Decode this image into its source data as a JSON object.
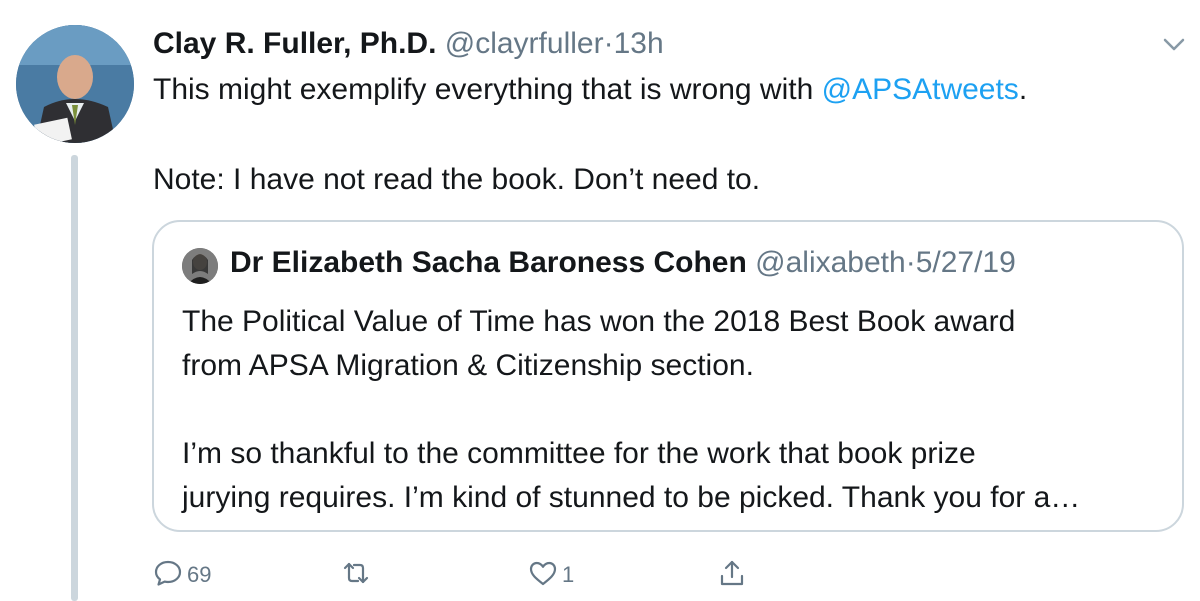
{
  "tweet": {
    "author_name": "Clay R. Fuller, Ph.D.",
    "author_handle": "@clayrfuller",
    "separator": "·",
    "time": "13h",
    "text_before_mention": "This might exemplify everything that is wrong with ",
    "mention": "@APSAtweets",
    "text_after_mention": ".",
    "note": "Note: I have not read the book. Don’t need to."
  },
  "quoted_tweet": {
    "author_name": "Dr Elizabeth Sacha Baroness Cohen",
    "author_handle": "@alixabeth",
    "separator": "·",
    "date": "5/27/19",
    "line1": "The Political Value of Time has won the 2018 Best Book award",
    "line2": "from APSA Migration & Citizenship section.",
    "line3": "I’m so thankful to the committee for the work that book prize",
    "line4": "jurying requires. I’m kind of stunned to be picked. Thank you for a…"
  },
  "actions": {
    "reply_count": "69",
    "retweet_count": "",
    "like_count": "1"
  },
  "icons": {
    "menu": "chevron-down-icon",
    "reply": "reply-icon",
    "retweet": "retweet-icon",
    "like": "heart-icon",
    "share": "share-icon"
  },
  "colors": {
    "link": "#1da1f2",
    "secondary_text": "#657786",
    "border": "#ccd6dd",
    "primary_text": "#14171a"
  }
}
